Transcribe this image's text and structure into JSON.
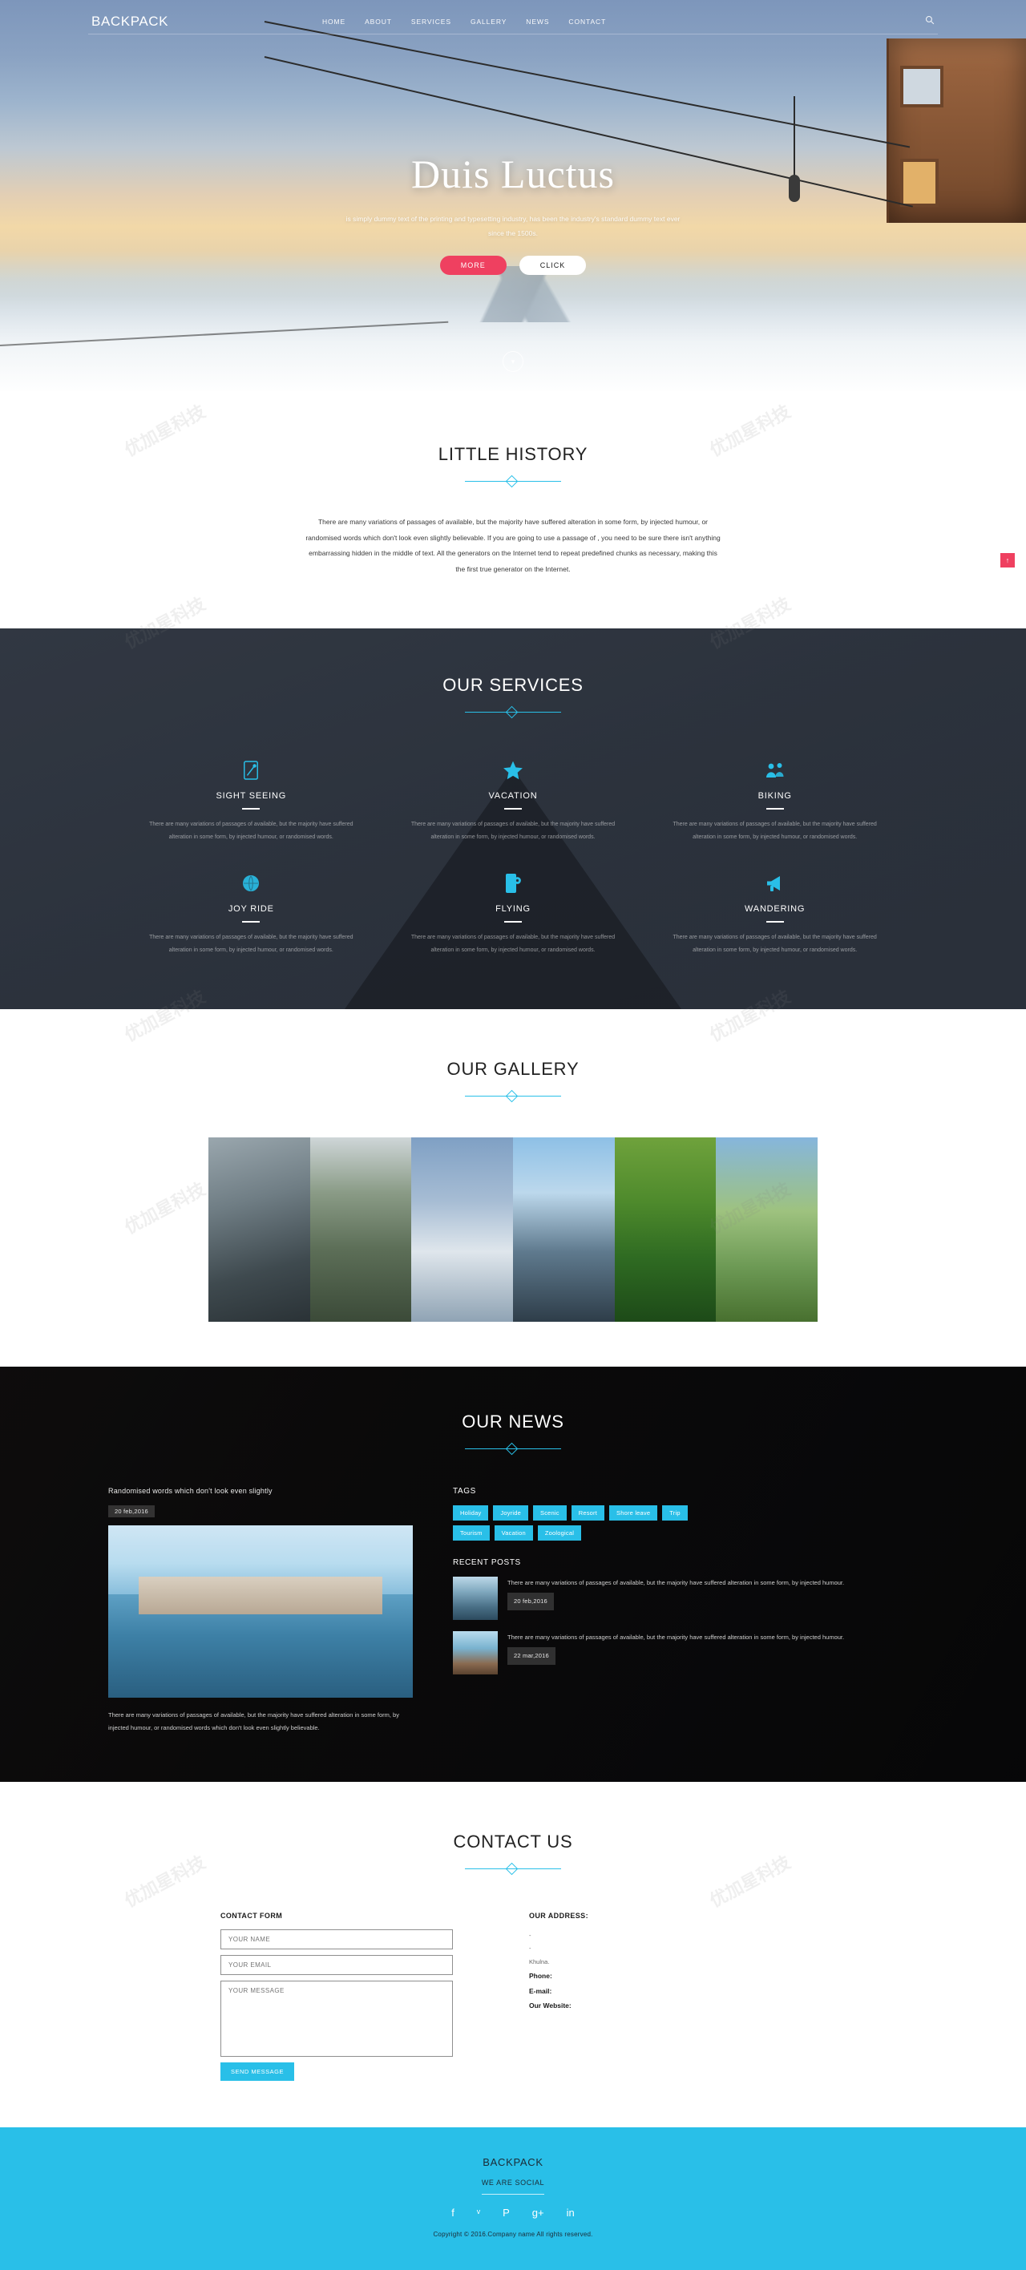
{
  "site": {
    "brand": "BACKPACK",
    "accent": "#29bfe8",
    "accent_pink": "#ef4060"
  },
  "nav": {
    "items": [
      {
        "label": "HOME",
        "active": true
      },
      {
        "label": "ABOUT",
        "active": false
      },
      {
        "label": "SERVICES",
        "active": false
      },
      {
        "label": "GALLERY",
        "active": false
      },
      {
        "label": "NEWS",
        "active": false
      },
      {
        "label": "CONTACT",
        "active": false
      }
    ],
    "search_icon": "search-icon"
  },
  "hero": {
    "title": "Duis Luctus",
    "subtitle": "is simply dummy text of the printing and typesetting industry, has been the industry's standard dummy text ever since the 1500s.",
    "btn_more": "MORE",
    "btn_click": "CLICK",
    "scroll_icon": "chevron-down-icon"
  },
  "history": {
    "title": "LITTLE HISTORY",
    "body": "There are many variations of passages of available, but the majority have suffered alteration in some form, by injected humour, or randomised words which don't look even slightly believable. If you are going to use a passage of , you need to be sure there isn't anything embarrassing hidden in the middle of text. All the generators on the Internet tend to repeat predefined chunks as necessary, making this the first true generator on the Internet."
  },
  "services": {
    "title": "OUR SERVICES",
    "items": [
      {
        "icon": "compass-icon",
        "title": "SIGHT SEEING",
        "text": "There are many variations of passages of available, but the majority have suffered alteration in some form, by injected humour, or randomised words."
      },
      {
        "icon": "star-icon",
        "title": "VACATION",
        "text": "There are many variations of passages of available, but the majority have suffered alteration in some form, by injected humour, or randomised words."
      },
      {
        "icon": "users-icon",
        "title": "BIKING",
        "text": "There are many variations of passages of available, but the majority have suffered alteration in some form, by injected humour, or randomised words."
      },
      {
        "icon": "globe-icon",
        "title": "JOY RIDE",
        "text": "There are many variations of passages of available, but the majority have suffered alteration in some form, by injected humour, or randomised words."
      },
      {
        "icon": "mobile-settings-icon",
        "title": "FLYING",
        "text": "There are many variations of passages of available, but the majority have suffered alteration in some form, by injected humour, or randomised words."
      },
      {
        "icon": "megaphone-icon",
        "title": "WANDERING",
        "text": "There are many variations of passages of available, but the majority have suffered alteration in some form, by injected humour, or randomised words."
      }
    ]
  },
  "gallery": {
    "title": "OUR GALLERY",
    "items": [
      {
        "name": "gallery-image-1"
      },
      {
        "name": "gallery-image-2"
      },
      {
        "name": "gallery-image-3"
      },
      {
        "name": "gallery-image-4"
      },
      {
        "name": "gallery-image-5"
      },
      {
        "name": "gallery-image-6"
      }
    ]
  },
  "news": {
    "title": "OUR NEWS",
    "post": {
      "title": "Randomised words which don't look even slightly",
      "date": "20 feb,2016",
      "body": "There are many variations of passages of available, but the majority have suffered alteration in some form, by injected humour, or randomised words which don't look even slightly believable."
    },
    "tags_heading": "TAGS",
    "tags": [
      "Holiday",
      "Joyride",
      "Scenic",
      "Resort",
      "Shore leave",
      "Trip",
      "Tourism",
      "Vacation",
      "Zoological"
    ],
    "recent_heading": "RECENT POSTS",
    "recent": [
      {
        "text": "There are many variations of passages of available, but the majority have suffered alteration in some form, by injected humour.",
        "date": "20 feb,2016"
      },
      {
        "text": "There are many variations of passages of available, but the majority have suffered alteration in some form, by injected humour.",
        "date": "22 mar,2016"
      }
    ]
  },
  "contact": {
    "title": "CONTACT US",
    "form_heading": "CONTACT FORM",
    "name_placeholder": "YOUR NAME",
    "email_placeholder": "YOUR EMAIL",
    "message_placeholder": "YOUR MESSAGE",
    "send_label": "SEND MESSAGE",
    "address_heading": "OUR ADDRESS:",
    "address_line1": "-",
    "address_line2": "-",
    "address_city": "Khulna.",
    "phone_label": "Phone:",
    "email_label": "E-mail:",
    "website_label": "Our Website:"
  },
  "footer": {
    "brand": "BACKPACK",
    "social_heading": "WE ARE SOCIAL",
    "socials": [
      {
        "name": "facebook-icon",
        "glyph": "f"
      },
      {
        "name": "twitter-icon",
        "glyph": "ᵛ"
      },
      {
        "name": "pinterest-icon",
        "glyph": "P"
      },
      {
        "name": "google-plus-icon",
        "glyph": "g+"
      },
      {
        "name": "linkedin-icon",
        "glyph": "in"
      }
    ],
    "copyright": "Copyright © 2016.Company name All rights reserved."
  },
  "scroll_top": {
    "icon": "arrow-up-icon",
    "glyph": "↑"
  }
}
